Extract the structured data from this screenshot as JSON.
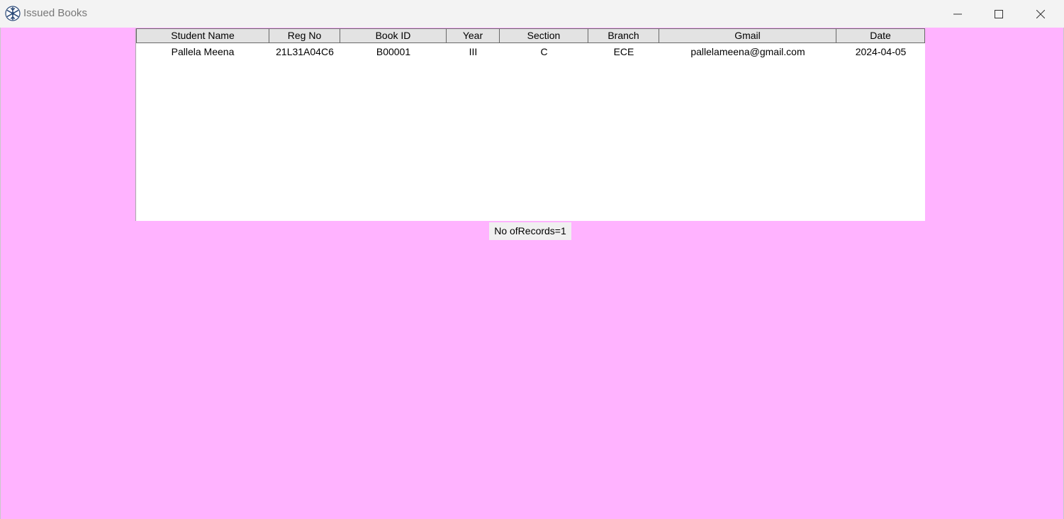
{
  "window": {
    "title": "Issued Books",
    "icon": "snowflake-app-icon",
    "background_color": "#ffb3ff"
  },
  "table": {
    "columns": [
      "Student Name",
      "Reg No",
      "Book ID",
      "Year",
      "Section",
      "Branch",
      "Gmail",
      "Date"
    ],
    "rows": [
      [
        "Pallela Meena",
        "21L31A04C6",
        "B00001",
        "III",
        "C",
        "ECE",
        "pallelameena@gmail.com",
        "2024-04-05"
      ]
    ]
  },
  "status": {
    "record_count_text": "No ofRecords=1"
  }
}
